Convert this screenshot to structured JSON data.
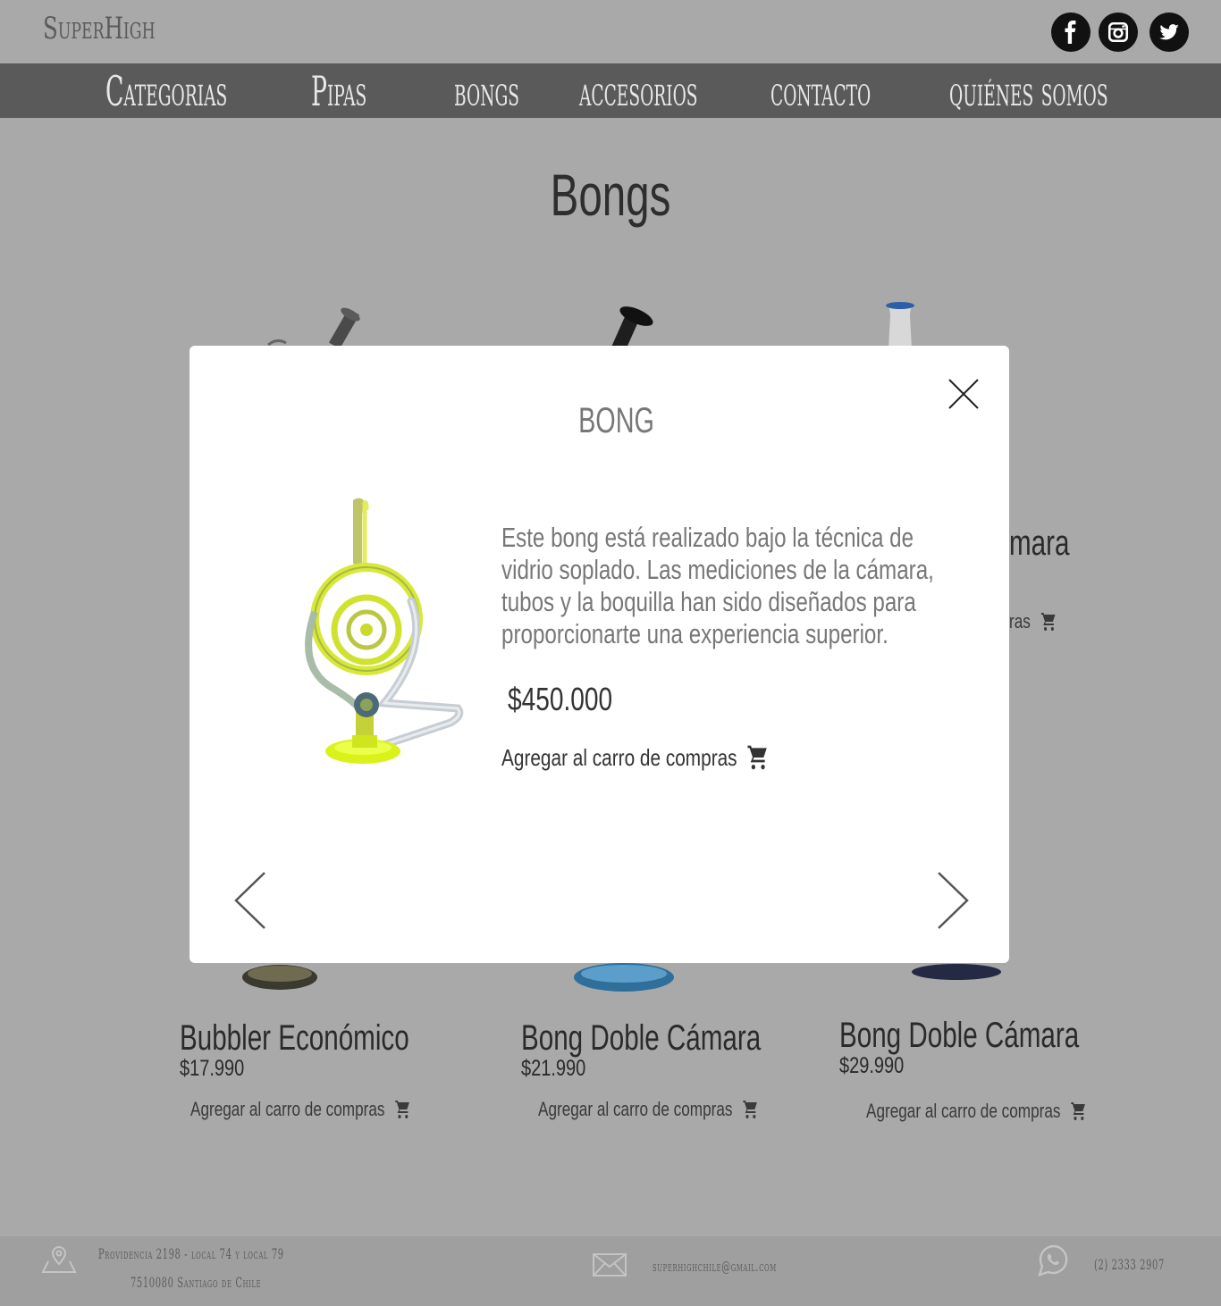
{
  "header": {
    "brand": "SuperHigh",
    "social": [
      "facebook-icon",
      "instagram-icon",
      "twitter-icon"
    ]
  },
  "nav": {
    "items": [
      {
        "label": "Categorias"
      },
      {
        "label": "Pipas"
      },
      {
        "label": "bongs"
      },
      {
        "label": "accesorios"
      },
      {
        "label": "contacto"
      },
      {
        "label": "quiénes somos"
      }
    ]
  },
  "main": {
    "title": "Bongs",
    "partial_name": "mara",
    "partial_cart": "ras",
    "products": [
      {
        "name": "Bubbler Económico",
        "price": "$17.990",
        "cart_label": "Agregar al carro de compras"
      },
      {
        "name": "Bong Doble Cámara",
        "price": "$21.990",
        "cart_label": "Agregar al carro de compras"
      },
      {
        "name": "Bong Doble Cámara",
        "price": "$29.990",
        "cart_label": "Agregar al carro de compras"
      }
    ]
  },
  "modal": {
    "title": "BONG",
    "description": "Este bong está realizado bajo la técnica de vidrio soplado. Las mediciones de la cámara, tubos y la boquilla han sido diseñados para proporcionarte una experiencia superior.",
    "price": "$450.000",
    "cart_label": "Agregar al carro de compras",
    "close_icon": "close-icon",
    "prev_icon": "chevron-left-icon",
    "next_icon": "chevron-right-icon"
  },
  "footer": {
    "address_line1": "Providencia 2198 - local 74 y local 79",
    "address_line2": "7510080 Santiago de Chile",
    "email": "superhighchile@gmail.com",
    "phone": "(2) 2333 2907"
  },
  "colors": {
    "overlay_bg": "#a9a9a9",
    "nav_bg": "#5a5a5a",
    "modal_bg": "#ffffff",
    "glass_yellow": "#d8f21a"
  }
}
